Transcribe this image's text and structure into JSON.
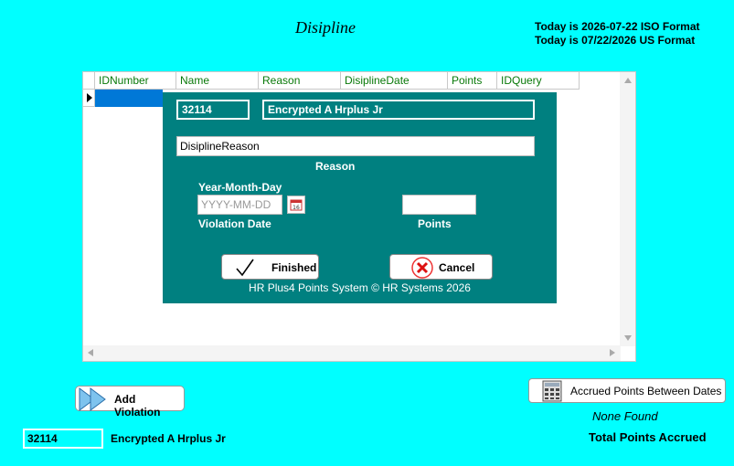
{
  "title": "Disipline",
  "today": {
    "iso": "Today is 2026-07-22 ISO Format",
    "us": "Today is 07/22/2026 US Format"
  },
  "grid": {
    "columns": [
      "IDNumber",
      "Name",
      "Reason",
      "DisiplineDate",
      "Points",
      "IDQuery"
    ]
  },
  "dialog": {
    "id_number": "32114",
    "name": "Encrypted A Hrplus Jr",
    "reason_value": "DisiplineReason",
    "reason_label": "Reason",
    "date_format_label": "Year-Month-Day",
    "date_placeholder": "YYYY-MM-DD",
    "date_label": "Violation Date",
    "points_value": "",
    "points_label": "Points",
    "finished_label": "Finished",
    "cancel_label": "Cancel",
    "footer": "HR Plus4 Points System © HR Systems 2026"
  },
  "add_violation_label": "Add Violation",
  "accrued_button_label": "Accrued Points Between Dates",
  "none_found": "None Found",
  "total_points_label": "Total Points Accrued",
  "employee": {
    "id": "32114",
    "name": "Encrypted A Hrplus Jr"
  },
  "colors": {
    "background": "#00ffff",
    "dialog": "#008080",
    "header_text": "#0a7a0a",
    "selection": "#0078d7"
  }
}
